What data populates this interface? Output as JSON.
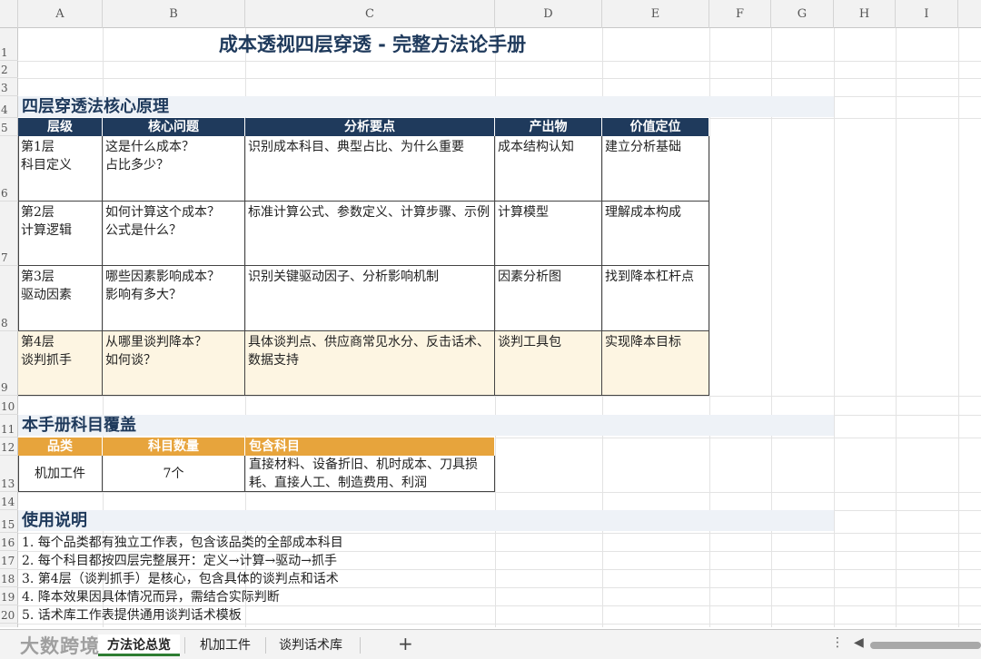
{
  "columns": [
    "A",
    "B",
    "C",
    "D",
    "E",
    "F",
    "G",
    "H",
    "I"
  ],
  "rows": [
    "1",
    "2",
    "3",
    "4",
    "5",
    "6",
    "7",
    "8",
    "9",
    "10",
    "11",
    "12",
    "13",
    "14",
    "15",
    "16",
    "17",
    "18",
    "19",
    "20"
  ],
  "title": "成本透视四层穿透 - 完整方法论手册",
  "section1": {
    "title": "四层穿透法核心原理",
    "headers": [
      "层级",
      "核心问题",
      "分析要点",
      "产出物",
      "价值定位"
    ],
    "rows": [
      {
        "level": "第1层\n科目定义",
        "question": "这是什么成本？\n占比多少？",
        "points": "识别成本科目、典型占比、为什么重要",
        "output": "成本结构认知",
        "value": "建立分析基础"
      },
      {
        "level": "第2层\n计算逻辑",
        "question": "如何计算这个成本？\n公式是什么？",
        "points": "标准计算公式、参数定义、计算步骤、示例",
        "output": "计算模型",
        "value": "理解成本构成"
      },
      {
        "level": "第3层\n驱动因素",
        "question": "哪些因素影响成本？\n影响有多大？",
        "points": "识别关键驱动因子、分析影响机制",
        "output": "因素分析图",
        "value": "找到降本杠杆点"
      },
      {
        "level": "第4层\n谈判抓手",
        "question": "从哪里谈判降本？\n如何谈？",
        "points": "具体谈判点、供应商常见水分、反击话术、数据支持",
        "output": "谈判工具包",
        "value": "实现降本目标"
      }
    ]
  },
  "section2": {
    "title": "本手册科目覆盖",
    "headers": [
      "品类",
      "科目数量",
      "包含科目"
    ],
    "row": {
      "category": "机加工件",
      "count": "7个",
      "items": "直接材料、设备折旧、机时成本、刀具损耗、直接人工、制造费用、利润"
    }
  },
  "section3": {
    "title": "使用说明",
    "notes": [
      "1.  每个品类都有独立工作表，包含该品类的全部成本科目",
      "2.  每个科目都按四层完整展开：定义→计算→驱动→抓手",
      "3.  第4层（谈判抓手）是核心，包含具体的谈判点和话术",
      "4.  降本效果因具体情况而异，需结合实际判断",
      "5.  话术库工作表提供通用谈判话术模板"
    ]
  },
  "tabs": {
    "items": [
      "方法论总览",
      "机加工件",
      "谈判话术库"
    ],
    "active": "方法论总览",
    "add": "+"
  },
  "watermark": "大数跨境",
  "colors": {
    "header_navy": "#1f3a5c",
    "header_orange": "#e7a43c",
    "highlight_row": "#fdf5e2"
  }
}
